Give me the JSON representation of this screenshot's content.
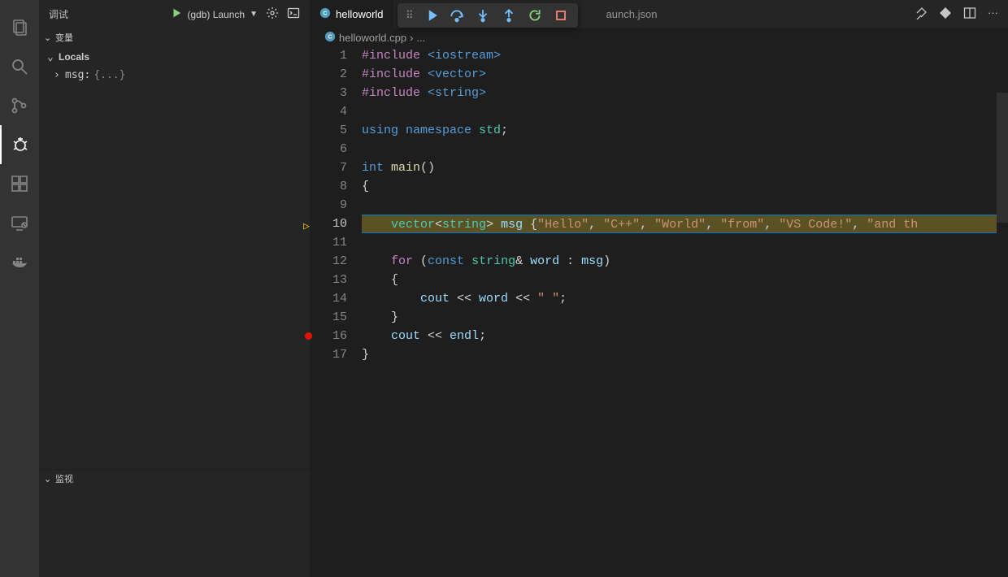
{
  "activity": {
    "items": [
      "explorer",
      "search",
      "scm",
      "debug",
      "extensions",
      "remote",
      "docker"
    ],
    "active": "debug"
  },
  "sidebar": {
    "title": "调试",
    "config_name": "(gdb) Launch",
    "sections": {
      "variables": "变量",
      "locals": "Locals",
      "watch": "监视"
    },
    "vars": [
      {
        "name": "msg:",
        "value": "{...}"
      }
    ]
  },
  "tabs": {
    "active": {
      "label": "helloworld",
      "icon": "cpp"
    },
    "inactive": {
      "label": "aunch.json",
      "icon": "json"
    }
  },
  "toolbar_icons": [
    "pin",
    "diamond",
    "split",
    "more"
  ],
  "debug_controls": [
    "grip",
    "continue",
    "step-over",
    "step-into",
    "step-out",
    "restart",
    "stop"
  ],
  "breadcrumb": {
    "file": "helloworld.cpp",
    "sep": "›",
    "rest": "..."
  },
  "editor": {
    "exec_line": 10,
    "breakpoints": [
      16
    ],
    "lines": [
      {
        "n": 1,
        "tokens": [
          [
            "pp",
            "#include "
          ],
          [
            "inc",
            "<iostream>"
          ]
        ]
      },
      {
        "n": 2,
        "tokens": [
          [
            "pp",
            "#include "
          ],
          [
            "inc",
            "<vector>"
          ]
        ]
      },
      {
        "n": 3,
        "tokens": [
          [
            "pp",
            "#include "
          ],
          [
            "inc",
            "<string>"
          ]
        ]
      },
      {
        "n": 4,
        "tokens": []
      },
      {
        "n": 5,
        "tokens": [
          [
            "kw",
            "using "
          ],
          [
            "kw",
            "namespace "
          ],
          [
            "ty",
            "std"
          ],
          [
            "op",
            ";"
          ]
        ]
      },
      {
        "n": 6,
        "tokens": []
      },
      {
        "n": 7,
        "tokens": [
          [
            "kw",
            "int "
          ],
          [
            "fn",
            "main"
          ],
          [
            "op",
            "()"
          ]
        ]
      },
      {
        "n": 8,
        "tokens": [
          [
            "op",
            "{"
          ]
        ]
      },
      {
        "n": 9,
        "tokens": []
      },
      {
        "n": 10,
        "indent": 1,
        "tokens": [
          [
            "ty",
            "vector"
          ],
          [
            "op",
            "<"
          ],
          [
            "ty",
            "string"
          ],
          [
            "op",
            "> "
          ],
          [
            "va",
            "msg"
          ],
          [
            "op",
            " {"
          ],
          [
            "st",
            "\"Hello\""
          ],
          [
            "op",
            ", "
          ],
          [
            "st",
            "\"C++\""
          ],
          [
            "op",
            ", "
          ],
          [
            "st",
            "\"World\""
          ],
          [
            "op",
            ", "
          ],
          [
            "st",
            "\"from\""
          ],
          [
            "op",
            ", "
          ],
          [
            "st",
            "\"VS Code!\""
          ],
          [
            "op",
            ", "
          ],
          [
            "st",
            "\"and th"
          ]
        ]
      },
      {
        "n": 11,
        "tokens": []
      },
      {
        "n": 12,
        "indent": 1,
        "tokens": [
          [
            "kw2",
            "for"
          ],
          [
            "op",
            " ("
          ],
          [
            "kw",
            "const "
          ],
          [
            "ty",
            "string"
          ],
          [
            "op",
            "& "
          ],
          [
            "va",
            "word"
          ],
          [
            "op",
            " : "
          ],
          [
            "va",
            "msg"
          ],
          [
            "op",
            ")"
          ]
        ]
      },
      {
        "n": 13,
        "indent": 1,
        "tokens": [
          [
            "op",
            "{"
          ]
        ]
      },
      {
        "n": 14,
        "indent": 2,
        "tokens": [
          [
            "id2",
            "cout"
          ],
          [
            "op",
            " << "
          ],
          [
            "va",
            "word"
          ],
          [
            "op",
            " << "
          ],
          [
            "st",
            "\" \""
          ],
          [
            "op",
            ";"
          ]
        ]
      },
      {
        "n": 15,
        "indent": 1,
        "tokens": [
          [
            "op",
            "}"
          ]
        ]
      },
      {
        "n": 16,
        "indent": 1,
        "tokens": [
          [
            "id2",
            "cout"
          ],
          [
            "op",
            " << "
          ],
          [
            "id2",
            "endl"
          ],
          [
            "op",
            ";"
          ]
        ]
      },
      {
        "n": 17,
        "tokens": [
          [
            "op",
            "}"
          ]
        ]
      }
    ]
  }
}
